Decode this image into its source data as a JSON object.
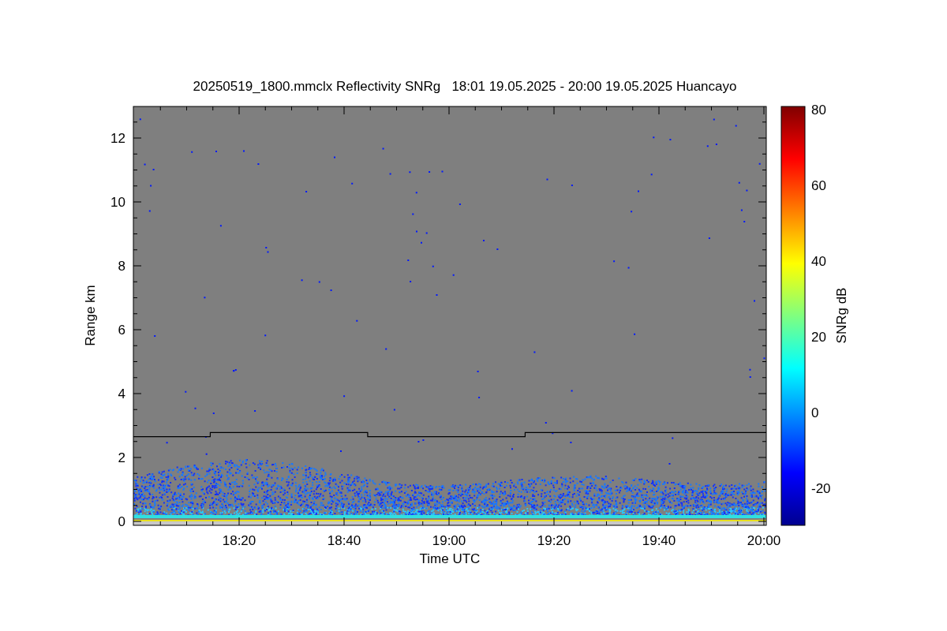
{
  "title": "20250519_1800.mmclx Reflectivity SNRg   18:01 19.05.2025 - 20:00 19.05.2025 Huancayo",
  "plot": {
    "ylabel": "Range km",
    "xlabel": "Time UTC",
    "yticks": [
      "12",
      "10",
      "8",
      "6",
      "4",
      "2",
      "0"
    ],
    "xticks": [
      "18:20",
      "18:40",
      "19:00",
      "19:20",
      "19:40",
      "20:00"
    ]
  },
  "colorbar": {
    "label": "SNRg dB",
    "ticks": [
      "80",
      "60",
      "40",
      "20",
      "0",
      "-20"
    ]
  }
}
